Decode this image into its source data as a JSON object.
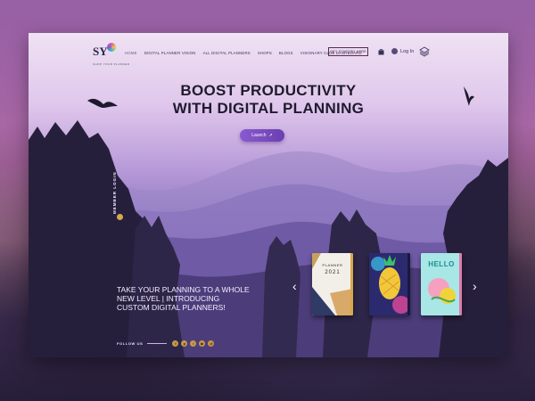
{
  "nav": {
    "logo_text": "SY",
    "logo_sub": "SHOP YOUR PLANNER",
    "links": [
      {
        "label": "HOME"
      },
      {
        "label": "DIGITAL PLANNER VISION"
      },
      {
        "label": "ALL DIGITAL PLANNERS"
      },
      {
        "label": "SHOPS"
      },
      {
        "label": "BLOGS"
      },
      {
        "label": "VISIONARY CLUB DASHBOARD"
      }
    ],
    "cta_label": "GET STARTED HERE",
    "login_label": "Log In"
  },
  "hero": {
    "headline_line1": "BOOST PRODUCTIVITY",
    "headline_line2": "WITH DIGITAL PLANNING",
    "launch_label": "Launch",
    "member_label": "MEMBER LOGIN",
    "tagline": "TAKE YOUR PLANNING TO A WHOLE NEW LEVEL | INTRODUCING CUSTOM DIGITAL PLANNERS!",
    "follow_label": "FOLLOW US"
  },
  "products": [
    {
      "title": "PLANNER",
      "year": "2021"
    },
    {
      "title": ""
    },
    {
      "title": "HELLO"
    }
  ],
  "social": [
    {
      "icon": "facebook-icon",
      "glyph": "f"
    },
    {
      "icon": "pinterest-icon",
      "glyph": "p"
    },
    {
      "icon": "instagram-icon",
      "glyph": "i"
    },
    {
      "icon": "youtube-icon",
      "glyph": "▶"
    },
    {
      "icon": "email-icon",
      "glyph": "@"
    }
  ],
  "colors": {
    "accent": "#7a4fc8",
    "cta_border": "#5a2a4a",
    "social_gold": "#c79a4a",
    "text_dark": "#1f1b2e"
  }
}
